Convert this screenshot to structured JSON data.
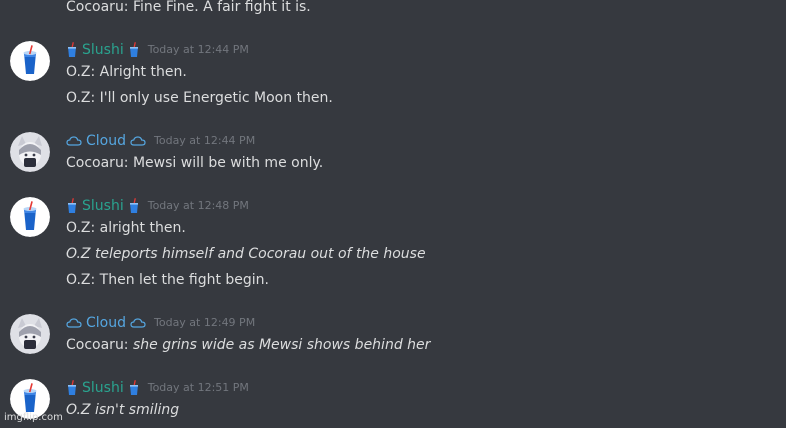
{
  "colors": {
    "background": "#36393f",
    "text": "#dcddde",
    "timestamp": "#72767d",
    "slushi_name": "#2aa38f",
    "cloud_name": "#55a6e0"
  },
  "icons": {
    "slushi_avatar": "blue-slushie-cup",
    "cloud_avatar": "anime-character",
    "cup_emoji": "cup-with-straw",
    "cloud_emoji": "cloud"
  },
  "top_message": "Cocoaru: Fine Fine. A fair fight it is.",
  "groups": [
    {
      "user": "Slushi",
      "deco": "🥤",
      "timestamp": "Today at 12:44 PM",
      "messages": [
        {
          "text": "O.Z: Alright then."
        },
        {
          "text": "O.Z: I'll only use Energetic Moon then."
        }
      ]
    },
    {
      "user": "Cloud",
      "deco": "♁",
      "timestamp": "Today at 12:44 PM",
      "messages": [
        {
          "text": "Cocoaru: Mewsi will be with me only."
        }
      ]
    },
    {
      "user": "Slushi",
      "deco": "🥤",
      "timestamp": "Today at 12:48 PM",
      "messages": [
        {
          "text": "O.Z: alright then."
        },
        {
          "text": "O.Z teleports himself and Cocorau out of the house"
        },
        {
          "text": "O.Z: Then let the fight begin."
        }
      ]
    },
    {
      "user": "Cloud",
      "deco": "♁",
      "timestamp": "Today at 12:49 PM",
      "messages": [
        {
          "prefix": "Cocoaru: ",
          "action": "she grins wide as Mewsi shows behind her"
        }
      ]
    },
    {
      "user": "Slushi",
      "deco": "🥤",
      "timestamp": "Today at 12:51 PM",
      "messages": [
        {
          "text": "O.Z isn't smiling"
        }
      ]
    }
  ],
  "watermark": "imgflip.com"
}
